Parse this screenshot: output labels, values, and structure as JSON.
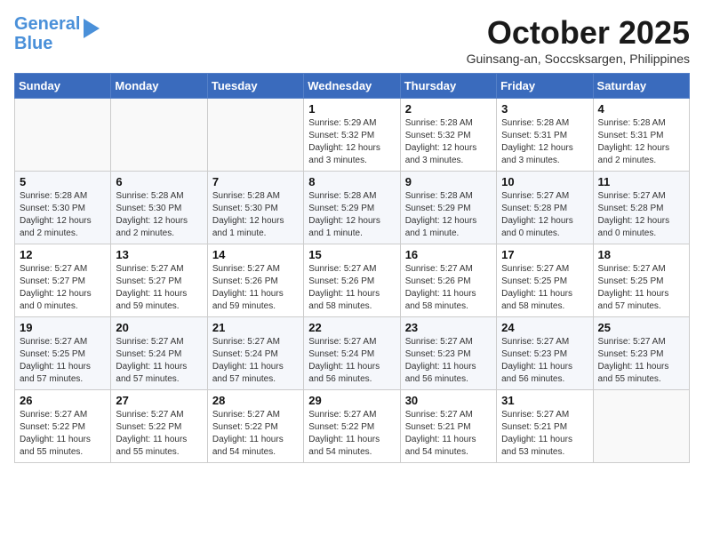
{
  "logo": {
    "line1": "General",
    "line2": "Blue"
  },
  "title": "October 2025",
  "location": "Guinsang-an, Soccsksargen, Philippines",
  "weekdays": [
    "Sunday",
    "Monday",
    "Tuesday",
    "Wednesday",
    "Thursday",
    "Friday",
    "Saturday"
  ],
  "weeks": [
    [
      {
        "day": "",
        "text": ""
      },
      {
        "day": "",
        "text": ""
      },
      {
        "day": "",
        "text": ""
      },
      {
        "day": "1",
        "text": "Sunrise: 5:29 AM\nSunset: 5:32 PM\nDaylight: 12 hours\nand 3 minutes."
      },
      {
        "day": "2",
        "text": "Sunrise: 5:28 AM\nSunset: 5:32 PM\nDaylight: 12 hours\nand 3 minutes."
      },
      {
        "day": "3",
        "text": "Sunrise: 5:28 AM\nSunset: 5:31 PM\nDaylight: 12 hours\nand 3 minutes."
      },
      {
        "day": "4",
        "text": "Sunrise: 5:28 AM\nSunset: 5:31 PM\nDaylight: 12 hours\nand 2 minutes."
      }
    ],
    [
      {
        "day": "5",
        "text": "Sunrise: 5:28 AM\nSunset: 5:30 PM\nDaylight: 12 hours\nand 2 minutes."
      },
      {
        "day": "6",
        "text": "Sunrise: 5:28 AM\nSunset: 5:30 PM\nDaylight: 12 hours\nand 2 minutes."
      },
      {
        "day": "7",
        "text": "Sunrise: 5:28 AM\nSunset: 5:30 PM\nDaylight: 12 hours\nand 1 minute."
      },
      {
        "day": "8",
        "text": "Sunrise: 5:28 AM\nSunset: 5:29 PM\nDaylight: 12 hours\nand 1 minute."
      },
      {
        "day": "9",
        "text": "Sunrise: 5:28 AM\nSunset: 5:29 PM\nDaylight: 12 hours\nand 1 minute."
      },
      {
        "day": "10",
        "text": "Sunrise: 5:27 AM\nSunset: 5:28 PM\nDaylight: 12 hours\nand 0 minutes."
      },
      {
        "day": "11",
        "text": "Sunrise: 5:27 AM\nSunset: 5:28 PM\nDaylight: 12 hours\nand 0 minutes."
      }
    ],
    [
      {
        "day": "12",
        "text": "Sunrise: 5:27 AM\nSunset: 5:27 PM\nDaylight: 12 hours\nand 0 minutes."
      },
      {
        "day": "13",
        "text": "Sunrise: 5:27 AM\nSunset: 5:27 PM\nDaylight: 11 hours\nand 59 minutes."
      },
      {
        "day": "14",
        "text": "Sunrise: 5:27 AM\nSunset: 5:26 PM\nDaylight: 11 hours\nand 59 minutes."
      },
      {
        "day": "15",
        "text": "Sunrise: 5:27 AM\nSunset: 5:26 PM\nDaylight: 11 hours\nand 58 minutes."
      },
      {
        "day": "16",
        "text": "Sunrise: 5:27 AM\nSunset: 5:26 PM\nDaylight: 11 hours\nand 58 minutes."
      },
      {
        "day": "17",
        "text": "Sunrise: 5:27 AM\nSunset: 5:25 PM\nDaylight: 11 hours\nand 58 minutes."
      },
      {
        "day": "18",
        "text": "Sunrise: 5:27 AM\nSunset: 5:25 PM\nDaylight: 11 hours\nand 57 minutes."
      }
    ],
    [
      {
        "day": "19",
        "text": "Sunrise: 5:27 AM\nSunset: 5:25 PM\nDaylight: 11 hours\nand 57 minutes."
      },
      {
        "day": "20",
        "text": "Sunrise: 5:27 AM\nSunset: 5:24 PM\nDaylight: 11 hours\nand 57 minutes."
      },
      {
        "day": "21",
        "text": "Sunrise: 5:27 AM\nSunset: 5:24 PM\nDaylight: 11 hours\nand 57 minutes."
      },
      {
        "day": "22",
        "text": "Sunrise: 5:27 AM\nSunset: 5:24 PM\nDaylight: 11 hours\nand 56 minutes."
      },
      {
        "day": "23",
        "text": "Sunrise: 5:27 AM\nSunset: 5:23 PM\nDaylight: 11 hours\nand 56 minutes."
      },
      {
        "day": "24",
        "text": "Sunrise: 5:27 AM\nSunset: 5:23 PM\nDaylight: 11 hours\nand 56 minutes."
      },
      {
        "day": "25",
        "text": "Sunrise: 5:27 AM\nSunset: 5:23 PM\nDaylight: 11 hours\nand 55 minutes."
      }
    ],
    [
      {
        "day": "26",
        "text": "Sunrise: 5:27 AM\nSunset: 5:22 PM\nDaylight: 11 hours\nand 55 minutes."
      },
      {
        "day": "27",
        "text": "Sunrise: 5:27 AM\nSunset: 5:22 PM\nDaylight: 11 hours\nand 55 minutes."
      },
      {
        "day": "28",
        "text": "Sunrise: 5:27 AM\nSunset: 5:22 PM\nDaylight: 11 hours\nand 54 minutes."
      },
      {
        "day": "29",
        "text": "Sunrise: 5:27 AM\nSunset: 5:22 PM\nDaylight: 11 hours\nand 54 minutes."
      },
      {
        "day": "30",
        "text": "Sunrise: 5:27 AM\nSunset: 5:21 PM\nDaylight: 11 hours\nand 54 minutes."
      },
      {
        "day": "31",
        "text": "Sunrise: 5:27 AM\nSunset: 5:21 PM\nDaylight: 11 hours\nand 53 minutes."
      },
      {
        "day": "",
        "text": ""
      }
    ]
  ]
}
